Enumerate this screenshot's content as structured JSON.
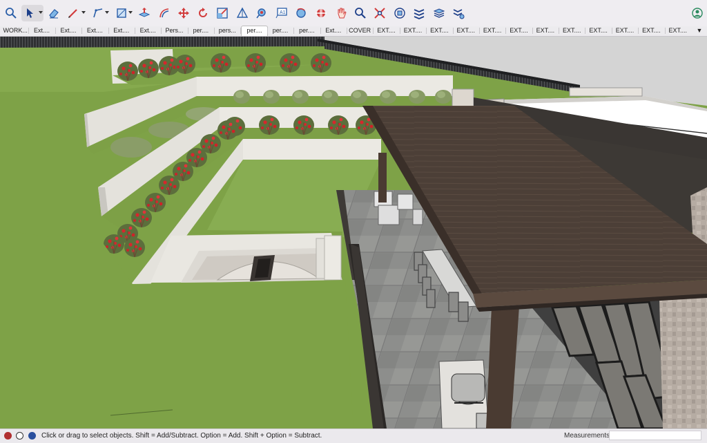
{
  "toolbar": {
    "tools": [
      {
        "name": "search-icon"
      },
      {
        "name": "select-arrow-icon"
      },
      {
        "name": "eraser-icon"
      },
      {
        "name": "pencil-line-icon"
      },
      {
        "name": "arc-icon"
      },
      {
        "name": "rectangle-icon"
      },
      {
        "name": "push-pull-icon"
      },
      {
        "name": "offset-icon"
      },
      {
        "name": "move-icon"
      },
      {
        "name": "rotate-icon"
      },
      {
        "name": "scale-icon"
      },
      {
        "name": "tape-measure-icon"
      },
      {
        "name": "paint-bucket-icon"
      },
      {
        "name": "text-tool-icon"
      },
      {
        "name": "orbit-icon"
      },
      {
        "name": "section-plane-icon"
      },
      {
        "name": "hand-pan-icon"
      },
      {
        "name": "zoom-icon"
      },
      {
        "name": "zoom-extents-icon"
      },
      {
        "name": "components-icon"
      },
      {
        "name": "tags-icon"
      },
      {
        "name": "layers-icon"
      },
      {
        "name": "tags-settings-icon"
      },
      {
        "name": "account-icon"
      }
    ]
  },
  "scenes": {
    "tabs": [
      "WORK...",
      "Ext....",
      "Ext....",
      "Ext....",
      "Ext....",
      "Ext....",
      "Pers...",
      "per....",
      "pers...",
      "per....",
      "per....",
      "per....",
      "Ext....",
      "COVER",
      "EXT....",
      "EXT....",
      "EXT....",
      "EXT....",
      "EXT....",
      "EXT....",
      "EXT....",
      "EXT....",
      "EXT....",
      "EXT....",
      "EXT....",
      "EXT...."
    ],
    "active_index": 9,
    "overflow_label": "▼"
  },
  "colors": {
    "grass": "#7ea247",
    "wall": "#e6e4de",
    "roof": "#4e4038",
    "sky": "#d8d8d8",
    "paving": "#8e8e8c",
    "accent_progress": "#f08a1e"
  },
  "status": {
    "hint": "Click or drag to select objects. Shift = Add/Subtract. Option = Add. Shift + Option = Subtract.",
    "measurements_label": "Measurements",
    "measurements_value": ""
  }
}
